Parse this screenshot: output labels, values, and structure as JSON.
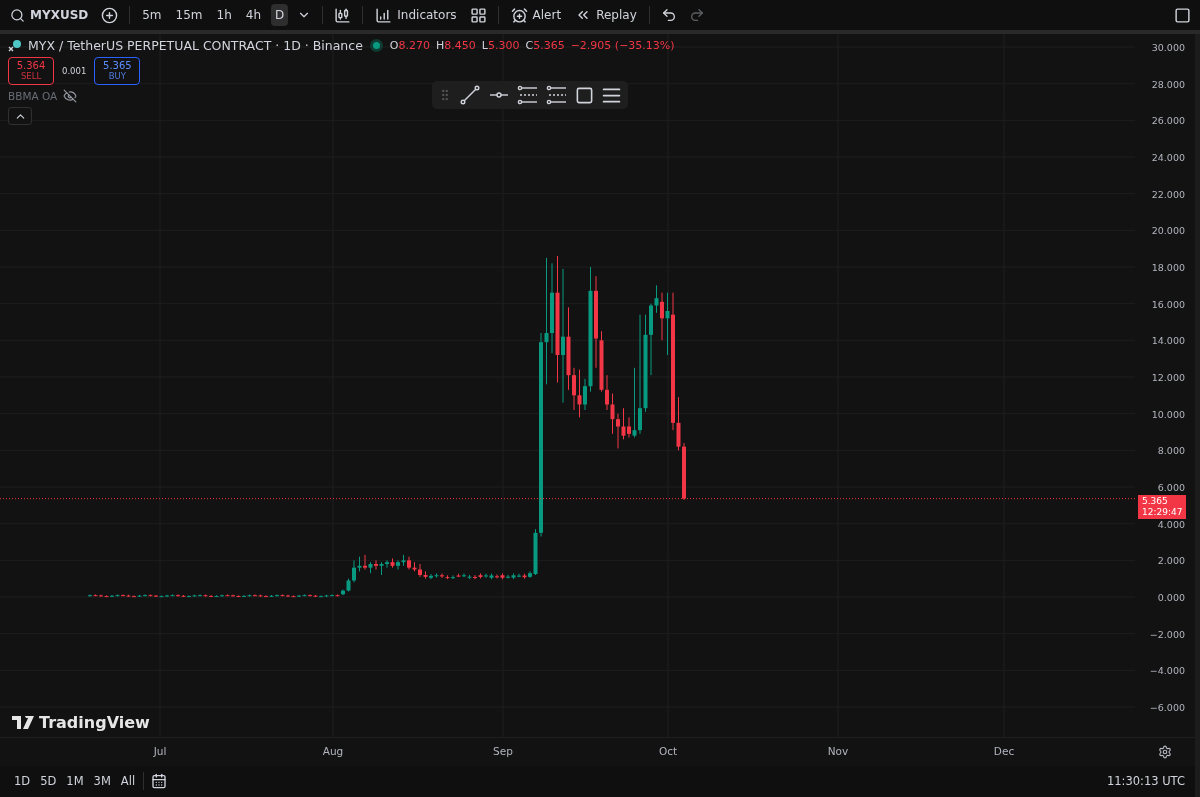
{
  "toolbar": {
    "symbol": "MYXUSD",
    "intervals": [
      {
        "label": "5m",
        "selected": false
      },
      {
        "label": "15m",
        "selected": false
      },
      {
        "label": "1h",
        "selected": false
      },
      {
        "label": "4h",
        "selected": false
      },
      {
        "label": "D",
        "selected": true
      }
    ],
    "indicators": "Indicators",
    "alert": "Alert",
    "replay": "Replay"
  },
  "legend": {
    "title": "MYX / TetherUS PERPETUAL CONTRACT · 1D · Binance",
    "market_open": true,
    "ohlc": [
      {
        "key": "O",
        "value": "8.270"
      },
      {
        "key": "H",
        "value": "8.450"
      },
      {
        "key": "L",
        "value": "5.300"
      },
      {
        "key": "C",
        "value": "5.365"
      }
    ],
    "change": "−2.905 (−35.13%)"
  },
  "trade": {
    "sell_price": "5.364",
    "sell_label": "SELL",
    "spread": "0.001",
    "buy_price": "5.365",
    "buy_label": "BUY"
  },
  "indicator": {
    "name": "BBMA OA",
    "hidden": true
  },
  "price_axis": {
    "labels": [
      "30.000",
      "28.000",
      "26.000",
      "24.000",
      "22.000",
      "20.000",
      "18.000",
      "16.000",
      "14.000",
      "12.000",
      "10.000",
      "8.000",
      "6.000",
      "4.000",
      "2.000",
      "0.000",
      "−2.000",
      "−4.000",
      "−6.000"
    ]
  },
  "last_price": {
    "price": "5.365",
    "countdown": "12:29:47"
  },
  "logo": "TradingView",
  "time_axis": {
    "labels": [
      "Jul",
      "Aug",
      "Sep",
      "Oct",
      "Nov",
      "Dec"
    ]
  },
  "bottom_bar": {
    "ranges": [
      "1D",
      "5D",
      "1M",
      "3M",
      "All"
    ],
    "clock": "11:30:13 UTC"
  }
}
